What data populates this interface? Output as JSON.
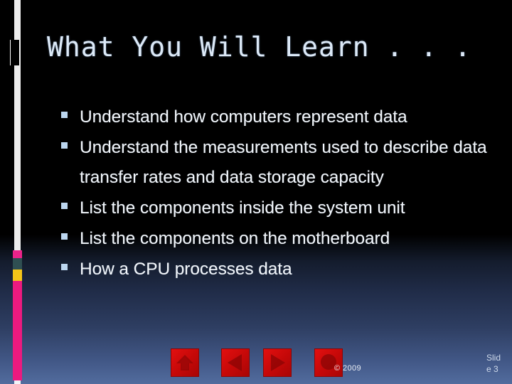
{
  "slide": {
    "title": "What You Will Learn . . .",
    "title_color": "#dce9f7",
    "background_top_color": "#000000",
    "background_bottom_color": "#526c9e",
    "bullet_color": "#bcd6ef",
    "body_text_color": "#f2f6fb",
    "bullets": [
      "Understand how computers represent data",
      "Understand the measurements used to describe data transfer rates and data storage capacity",
      "List the components inside the system unit",
      "List the components on the motherboard",
      "How a CPU processes data"
    ],
    "copyright": "© 2009",
    "slide_number": "Slide 3"
  },
  "decoration": {
    "strip_color": "#ffffff",
    "segments": [
      {
        "name": "magenta-top",
        "color": "#ec2389"
      },
      {
        "name": "teal",
        "color": "#2f4f52"
      },
      {
        "name": "yellow",
        "color": "#f5c518"
      },
      {
        "name": "magenta-long",
        "color": "#ec1a7f"
      }
    ]
  },
  "nav": {
    "button_color": "#c40808",
    "buttons": [
      {
        "name": "home",
        "label": "Home"
      },
      {
        "name": "previous",
        "label": "Previous"
      },
      {
        "name": "next",
        "label": "Next"
      },
      {
        "name": "stop",
        "label": "Stop"
      }
    ]
  }
}
